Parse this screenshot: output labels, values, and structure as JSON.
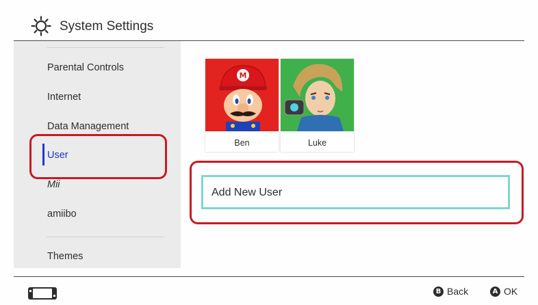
{
  "header": {
    "title": "System Settings",
    "icon": "gear-icon"
  },
  "sidebar": {
    "items": [
      {
        "label": "Parental Controls"
      },
      {
        "label": "Internet"
      },
      {
        "label": "Data Management"
      },
      {
        "label": "User",
        "selected": true
      },
      {
        "label": "Mii"
      },
      {
        "label": "amiibo"
      },
      {
        "label": "Themes"
      }
    ]
  },
  "users": [
    {
      "name": "Ben",
      "avatar": "mario-avatar"
    },
    {
      "name": "Luke",
      "avatar": "link-avatar"
    }
  ],
  "add_user": {
    "label": "Add New User"
  },
  "footer": {
    "back": {
      "glyph": "B",
      "label": "Back"
    },
    "ok": {
      "glyph": "A",
      "label": "OK"
    }
  },
  "colors": {
    "selection": "#1d36c8",
    "focus_border": "#7fd7cf",
    "annotation_red": "#c61a24"
  }
}
